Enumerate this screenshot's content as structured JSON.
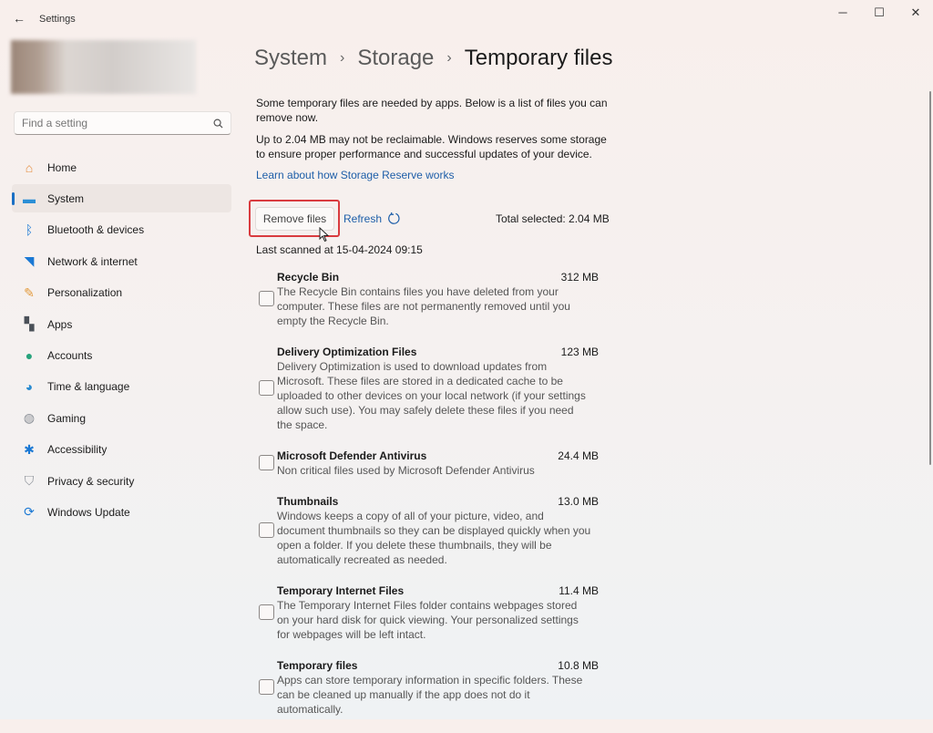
{
  "window": {
    "title": "Settings",
    "back_icon": "←",
    "minimize": "─",
    "maximize": "☐",
    "close": "✕"
  },
  "sidebar": {
    "search_placeholder": "Find a setting",
    "items": [
      {
        "label": "Home",
        "icon": "home-icon",
        "color": "#e58b3a"
      },
      {
        "label": "System",
        "icon": "system-icon",
        "color": "#2b8fd6",
        "selected": true
      },
      {
        "label": "Bluetooth & devices",
        "icon": "bluetooth-icon",
        "color": "#1a78d4"
      },
      {
        "label": "Network & internet",
        "icon": "wifi-icon",
        "color": "#1a78d4"
      },
      {
        "label": "Personalization",
        "icon": "brush-icon",
        "color": "#e39a3c"
      },
      {
        "label": "Apps",
        "icon": "apps-icon",
        "color": "#4a5058"
      },
      {
        "label": "Accounts",
        "icon": "person-icon",
        "color": "#27a37c"
      },
      {
        "label": "Time & language",
        "icon": "globe-icon",
        "color": "#2a8bd0"
      },
      {
        "label": "Gaming",
        "icon": "gamepad-icon",
        "color": "#8b9097"
      },
      {
        "label": "Accessibility",
        "icon": "accessibility-icon",
        "color": "#1a78d4"
      },
      {
        "label": "Privacy & security",
        "icon": "shield-icon",
        "color": "#8d9299"
      },
      {
        "label": "Windows Update",
        "icon": "update-icon",
        "color": "#1a78d4"
      }
    ]
  },
  "breadcrumb": {
    "items": [
      "System",
      "Storage"
    ],
    "current": "Temporary files",
    "sep": "›"
  },
  "main": {
    "intro": "Some temporary files are needed by apps. Below is a list of files you can remove now.",
    "reserve": "Up to 2.04 MB may not be reclaimable. Windows reserves some storage to ensure proper performance and successful updates of your device.",
    "learn_link": "Learn about how Storage Reserve works",
    "remove_label": "Remove files",
    "refresh_label": "Refresh",
    "total_selected": "Total selected: 2.04 MB",
    "last_scanned": "Last scanned at 15-04-2024 09:15",
    "files": [
      {
        "name": "Recycle Bin",
        "size": "312 MB",
        "desc": "The Recycle Bin contains files you have deleted from your computer. These files are not permanently removed until you empty the Recycle Bin."
      },
      {
        "name": "Delivery Optimization Files",
        "size": "123 MB",
        "desc": "Delivery Optimization is used to download updates from Microsoft. These files are stored in a dedicated cache to be uploaded to other devices on your local network (if your settings allow such use). You may safely delete these files if you need the space."
      },
      {
        "name": "Microsoft Defender Antivirus",
        "size": "24.4 MB",
        "desc": "Non critical files used by Microsoft Defender Antivirus"
      },
      {
        "name": "Thumbnails",
        "size": "13.0 MB",
        "desc": "Windows keeps a copy of all of your picture, video, and document thumbnails so they can be displayed quickly when you open a folder. If you delete these thumbnails, they will be automatically recreated as needed."
      },
      {
        "name": "Temporary Internet Files",
        "size": "11.4 MB",
        "desc": "The Temporary Internet Files folder contains webpages stored on your hard disk for quick viewing. Your personalized settings for webpages will be left intact."
      },
      {
        "name": "Temporary files",
        "size": "10.8 MB",
        "desc": "Apps can store temporary information in specific folders. These can be cleaned up manually if the app does not do it automatically."
      }
    ]
  }
}
